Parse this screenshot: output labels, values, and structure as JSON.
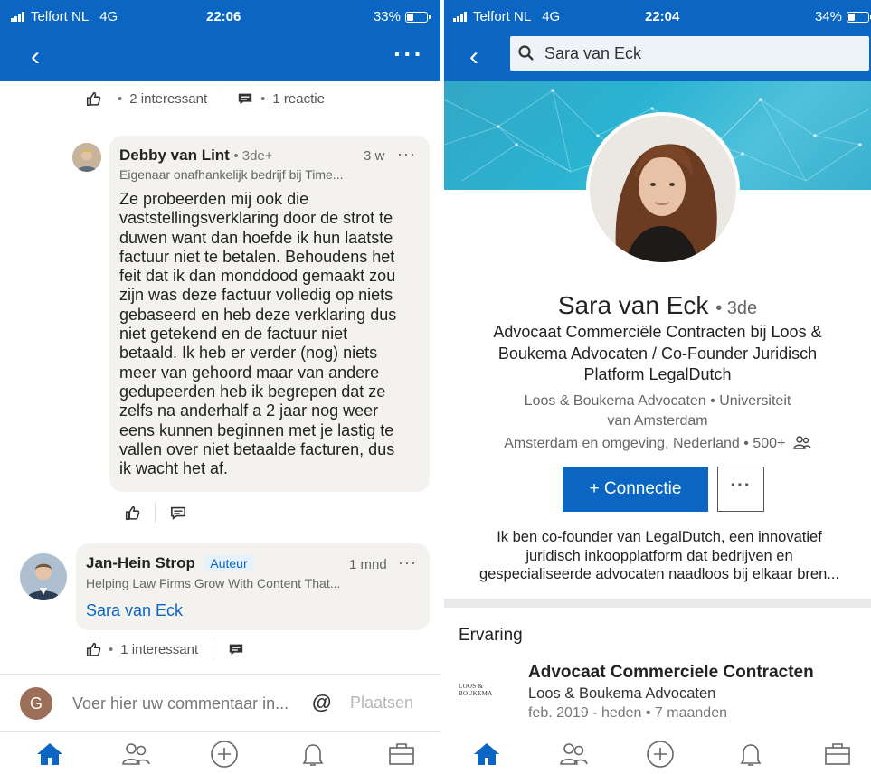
{
  "left": {
    "status": {
      "carrier": "Telfort NL",
      "network": "4G",
      "time": "22:06",
      "battery": "33%",
      "battery_level": 0.33
    },
    "post_reactions": {
      "likes": "2 interessant",
      "comments": "1 reactie"
    },
    "comment1": {
      "name": "Debby van Lint",
      "degree": "3de+",
      "time": "3 w",
      "headline": "Eigenaar onafhankelijk bedrijf bij Time...",
      "text_lines": [
        "Ze probeerden mij ook die",
        "vaststellingsverklaring door de strot te",
        "duwen want dan hoefde ik hun laatste",
        "factuur niet te betalen. Behoudens het",
        "feit dat ik dan monddood gemaakt zou",
        "zijn was deze factuur volledig op niets",
        "gebaseerd en heb deze verklaring dus",
        "niet getekend en de factuur niet",
        "betaald. Ik heb er verder (nog) niets",
        "meer van gehoord maar van andere",
        "gedupeerden heb ik begrepen dat ze",
        "zelfs na anderhalf a 2 jaar nog weer",
        "eens kunnen beginnen met je lastig te",
        "vallen over niet betaalde facturen, dus",
        "ik wacht het af."
      ]
    },
    "comment2": {
      "name": "Jan-Hein Strop",
      "badge": "Auteur",
      "time": "1 mnd",
      "headline": "Helping Law Firms Grow With Content That...",
      "mention": "Sara van Eck",
      "likes": "1 interessant"
    },
    "composer": {
      "avatar_letter": "G",
      "placeholder": "Voer hier uw commentaar in...",
      "at_symbol": "@",
      "post_label": "Plaatsen"
    }
  },
  "right": {
    "status": {
      "carrier": "Telfort NL",
      "network": "4G",
      "time": "22:04",
      "battery": "34%",
      "battery_level": 0.34
    },
    "search_query": "Sara van Eck",
    "profile": {
      "name": "Sara van Eck",
      "degree": "3de",
      "headline_lines": [
        "Advocaat Commerciële Contracten bij Loos &",
        "Boukema Advocaten / Co-Founder Juridisch",
        "Platform LegalDutch"
      ],
      "sub_lines": [
        "Loos & Boukema Advocaten • Universiteit",
        "van Amsterdam"
      ],
      "location": "Amsterdam en omgeving, Nederland • 500+",
      "connect_label": "+ Connectie",
      "about_lines": [
        "Ik ben co-founder van LegalDutch, een innovatief",
        "juridisch inkoopplatform dat bedrijven en",
        "gespecialiseerde advocaten naadloos bij elkaar bren..."
      ]
    },
    "experience": {
      "section_title": "Ervaring",
      "logo_text": "LOOS & BOUKEMA",
      "role": "Advocaat Commerciele Contracten",
      "company": "Loos & Boukema Advocaten",
      "dates": "feb. 2019 - heden • 7 maanden"
    }
  },
  "colors": {
    "brand": "#0a66c2",
    "bubble": "#f3f2ef"
  },
  "tabs": [
    "home-icon",
    "network-icon",
    "post-icon",
    "notifications-icon",
    "jobs-icon"
  ]
}
